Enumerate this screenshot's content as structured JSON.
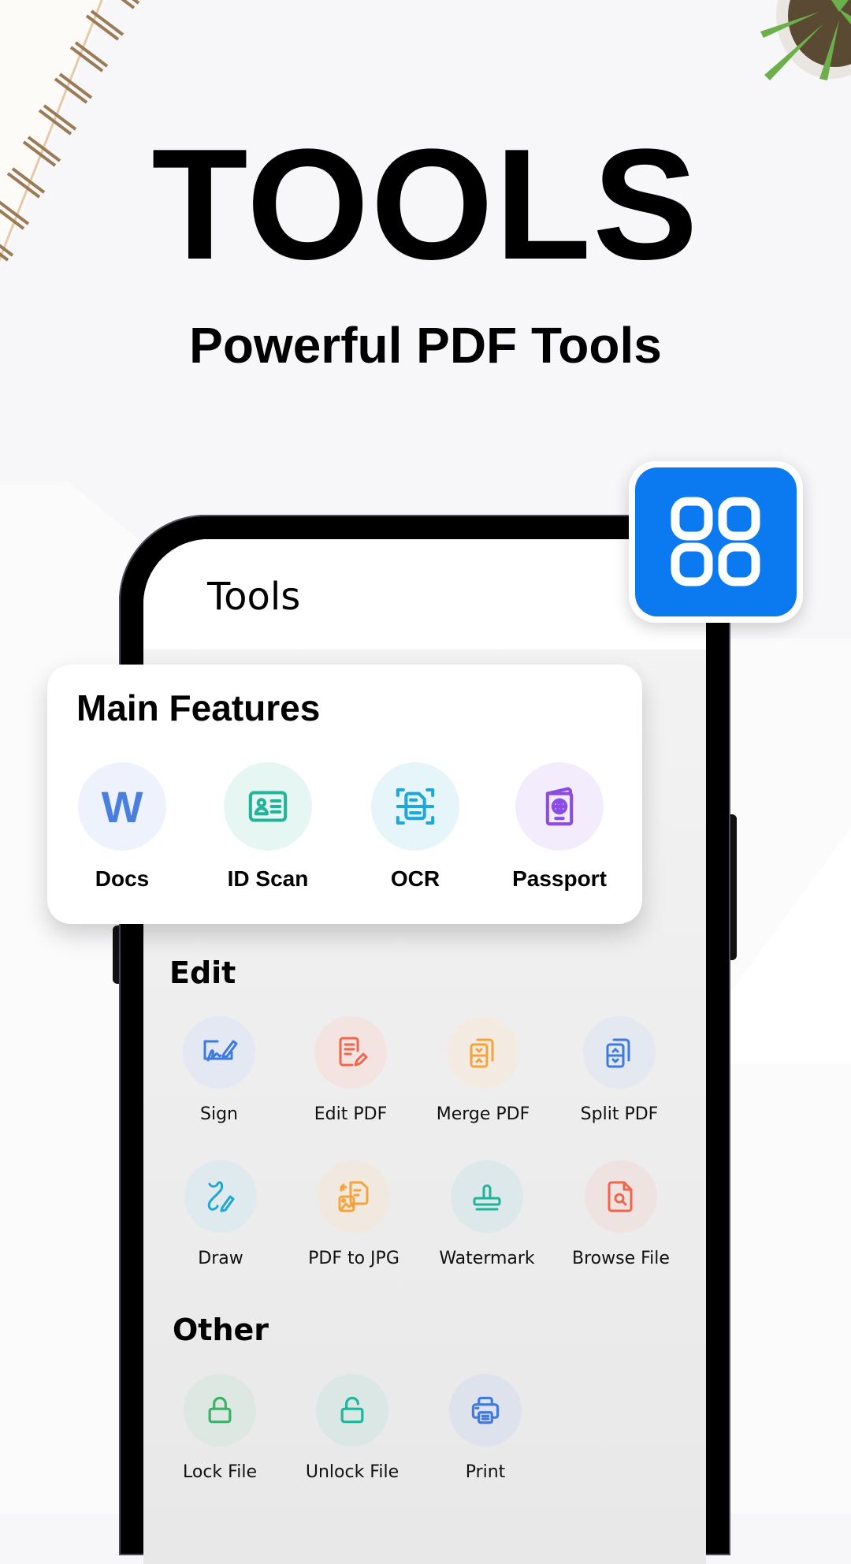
{
  "hero": {
    "title": "TOOLS",
    "subtitle": "Powerful PDF Tools"
  },
  "badge": {
    "icon": "apps-grid-icon",
    "color": "#0b7af0"
  },
  "screen": {
    "title": "Tools"
  },
  "main_features": {
    "title": "Main Features",
    "items": [
      {
        "label": "Docs",
        "icon": "word-doc-icon",
        "color": "#4a7fe0",
        "bg": "#edf2fd"
      },
      {
        "label": "ID Scan",
        "icon": "id-card-icon",
        "color": "#22b39a",
        "bg": "#e6f7f3"
      },
      {
        "label": "OCR",
        "icon": "ocr-scan-icon",
        "color": "#1ea8d8",
        "bg": "#e6f5fa"
      },
      {
        "label": "Passport",
        "icon": "passport-icon",
        "color": "#8b4be6",
        "bg": "#f3ecfd"
      }
    ]
  },
  "edit": {
    "title": "Edit",
    "items": [
      {
        "label": "Sign",
        "icon": "signature-icon",
        "color": "#3e7ae0",
        "bg": "#e3e8f3"
      },
      {
        "label": "Edit PDF",
        "icon": "edit-document-icon",
        "color": "#f2644c",
        "bg": "#f3e4e2"
      },
      {
        "label": "Merge PDF",
        "icon": "merge-files-icon",
        "color": "#f5a33c",
        "bg": "#f3ebe2"
      },
      {
        "label": "Split PDF",
        "icon": "split-files-icon",
        "color": "#3e7ae0",
        "bg": "#e3e8f1"
      },
      {
        "label": "Draw",
        "icon": "draw-pen-icon",
        "color": "#21a6d4",
        "bg": "#dfeaef"
      },
      {
        "label": "PDF to JPG",
        "icon": "pdf-to-image-icon",
        "color": "#f5a33c",
        "bg": "#f1e9df"
      },
      {
        "label": "Watermark",
        "icon": "stamp-icon",
        "color": "#20b39b",
        "bg": "#dce8ea"
      },
      {
        "label": "Browse File",
        "icon": "file-search-icon",
        "color": "#f2644c",
        "bg": "#efe3e2"
      }
    ]
  },
  "other": {
    "title": "Other",
    "items": [
      {
        "label": "Lock File",
        "icon": "lock-icon",
        "color": "#3fb06a",
        "bg": "#dce8e1"
      },
      {
        "label": "Unlock File",
        "icon": "unlock-icon",
        "color": "#1fb59b",
        "bg": "#dbe7e5"
      },
      {
        "label": "Print",
        "icon": "printer-icon",
        "color": "#3e7ae0",
        "bg": "#dee2ec"
      }
    ]
  }
}
